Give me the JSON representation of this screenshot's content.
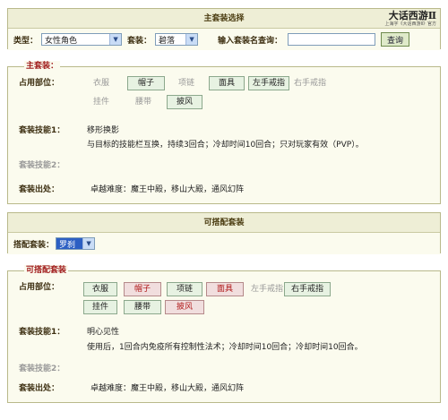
{
  "header": {
    "title": "主套装选择",
    "logo_text": "大话西游Ⅱ",
    "logo_sub": "上海字《大话西游Ⅱ》官方"
  },
  "filter": {
    "type_label": "类型：",
    "type_value": "女性角色",
    "set_label": "套装：",
    "set_value": "碧落",
    "search_label": "输入套装名查询：",
    "search_value": "",
    "search_button": "查询"
  },
  "main_set": {
    "legend": "主套装：",
    "slots_label": "占用部位：",
    "slots": [
      {
        "label": "衣服",
        "state": "off"
      },
      {
        "label": "帽子",
        "state": "on"
      },
      {
        "label": "项链",
        "state": "off"
      },
      {
        "label": "面具",
        "state": "on"
      },
      {
        "label": "左手戒指",
        "state": "on"
      },
      {
        "label": "右手戒指",
        "state": "off"
      },
      {
        "label": "挂件",
        "state": "off"
      },
      {
        "label": "腰带",
        "state": "off"
      },
      {
        "label": "披风",
        "state": "on"
      }
    ],
    "skill1_label": "套装技能1：",
    "skill1_name": "移形换影",
    "skill1_desc": "与目标的技能栏互换，持续3回合；冷却时间10回合；只对玩家有效（PVP）。",
    "skill2_label": "套装技能2：",
    "source_label": "套装出处：",
    "source_value": "卓越难度：魔王中殿，移山大殿，通风幻阵"
  },
  "combo_header": {
    "title": "可搭配套装"
  },
  "combo_filter": {
    "label": "搭配套装：",
    "value": "罗刹"
  },
  "combo_set": {
    "legend": "可搭配套装",
    "slots_label": "占用部位：",
    "slots": [
      {
        "label": "衣服",
        "state": "on"
      },
      {
        "label": "帽子",
        "state": "red"
      },
      {
        "label": "项链",
        "state": "on"
      },
      {
        "label": "面具",
        "state": "red"
      },
      {
        "label": "左手戒指",
        "state": "off"
      },
      {
        "label": "右手戒指",
        "state": "on"
      },
      {
        "label": "挂件",
        "state": "on"
      },
      {
        "label": "腰带",
        "state": "on"
      },
      {
        "label": "披风",
        "state": "red"
      }
    ],
    "skill1_label": "套装技能1：",
    "skill1_name": "明心见性",
    "skill1_desc": "使用后，1回合内免疫所有控制性法术；冷却时间10回合；冷却时间10回合。",
    "skill2_label": "套装技能2：",
    "source_label": "套装出处：",
    "source_value": "卓越难度：魔王中殿，移山大殿，通风幻阵"
  }
}
